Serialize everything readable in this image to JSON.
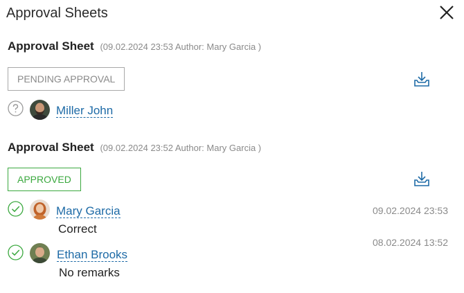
{
  "panel": {
    "title": "Approval Sheets"
  },
  "sheets": [
    {
      "title": "Approval Sheet",
      "meta": "(09.02.2024 23:53 Author: Mary Garcia )",
      "status": "PENDING APPROVAL",
      "approvers": [
        {
          "name": "Miller John",
          "state": "pending",
          "comment": "",
          "timestamp": ""
        }
      ]
    },
    {
      "title": "Approval Sheet",
      "meta": "(09.02.2024 23:52 Author: Mary Garcia )",
      "status": "APPROVED",
      "approvers": [
        {
          "name": "Mary Garcia",
          "state": "approved",
          "comment": "Correct",
          "timestamp": "09.02.2024 23:53"
        },
        {
          "name": "Ethan Brooks",
          "state": "approved",
          "comment": "No remarks",
          "timestamp": "08.02.2024 13:52"
        }
      ]
    }
  ],
  "colors": {
    "link": "#1d6aa6",
    "approved": "#3aa83e",
    "muted": "#8a8a8a"
  }
}
